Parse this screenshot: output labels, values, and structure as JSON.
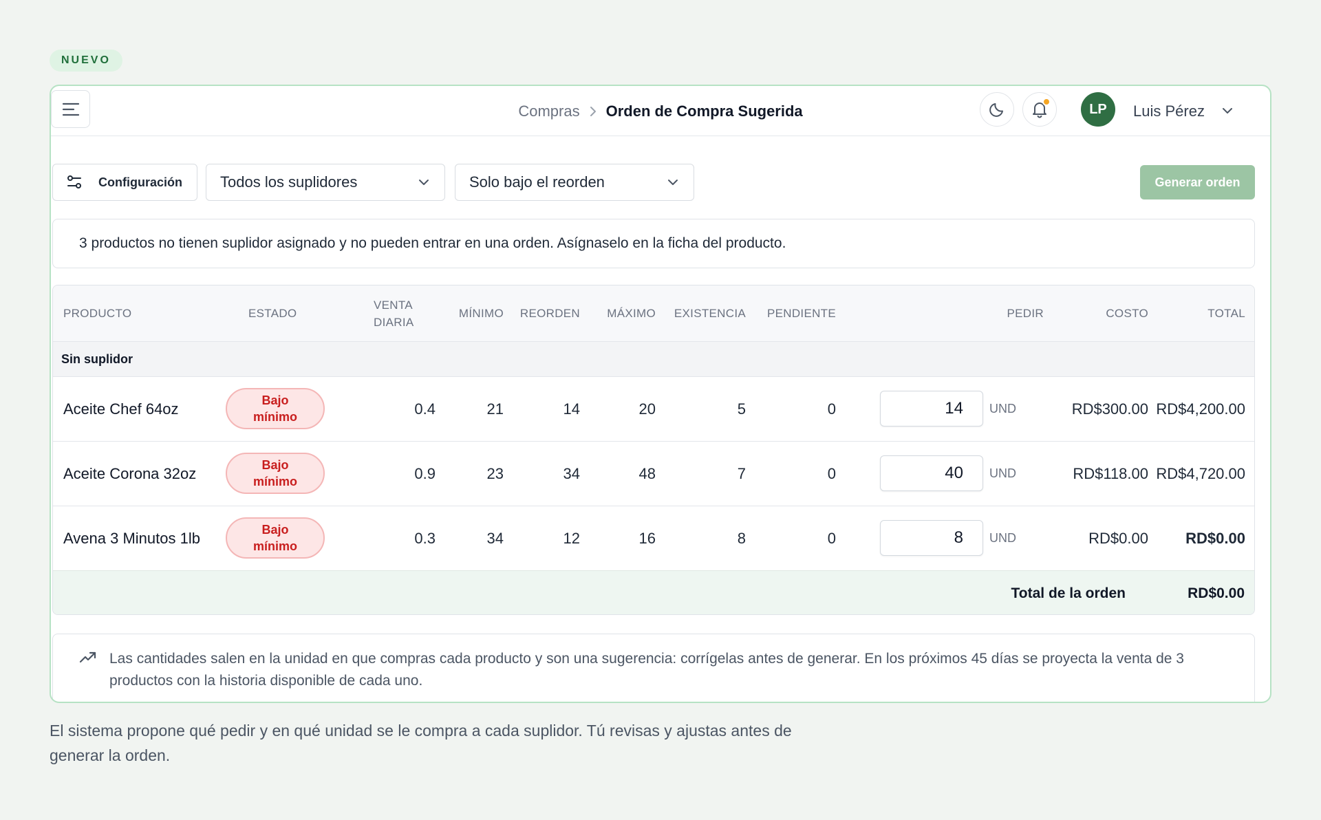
{
  "badge": "NUEVO",
  "header": {
    "breadcrumb_parent": "Compras",
    "breadcrumb_current": "Orden de Compra Sugerida",
    "user_initials": "LP",
    "user_name": "Luis Pérez"
  },
  "toolbar": {
    "config_label": "Configuración",
    "supplier_filter": "Todos los suplidores",
    "reorder_filter": "Solo bajo el reorden",
    "generate_label": "Generar orden"
  },
  "notice": "3 productos no tienen suplidor asignado y no pueden entrar en una orden. Asígnaselo en la ficha del producto.",
  "table": {
    "columns": {
      "producto": "PRODUCTO",
      "estado": "ESTADO",
      "venta_diaria_1": "VENTA",
      "venta_diaria_2": "DIARIA",
      "minimo": "MÍNIMO",
      "reorden": "REORDEN",
      "maximo": "MÁXIMO",
      "existencia": "EXISTENCIA",
      "pendiente": "PENDIENTE",
      "pedir": "PEDIR",
      "costo": "COSTO",
      "total": "TOTAL"
    },
    "group_label": "Sin suplidor",
    "rows": [
      {
        "producto": "Aceite Chef 64oz",
        "estado_1": "Bajo",
        "estado_2": "mínimo",
        "venta_diaria": "0.4",
        "minimo": "21",
        "reorden": "14",
        "maximo": "20",
        "existencia": "5",
        "pendiente": "0",
        "pedir": "14",
        "unidad": "UND",
        "costo": "RD$300.00",
        "total": "RD$4,200.00"
      },
      {
        "producto": "Aceite Corona 32oz",
        "estado_1": "Bajo",
        "estado_2": "mínimo",
        "venta_diaria": "0.9",
        "minimo": "23",
        "reorden": "34",
        "maximo": "48",
        "existencia": "7",
        "pendiente": "0",
        "pedir": "40",
        "unidad": "UND",
        "costo": "RD$118.00",
        "total": "RD$4,720.00"
      },
      {
        "producto": "Avena 3 Minutos 1lb",
        "estado_1": "Bajo",
        "estado_2": "mínimo",
        "venta_diaria": "0.3",
        "minimo": "34",
        "reorden": "12",
        "maximo": "16",
        "existencia": "8",
        "pendiente": "0",
        "pedir": "8",
        "unidad": "UND",
        "costo": "RD$0.00",
        "total": "RD$0.00"
      }
    ],
    "total_label": "Total de la orden",
    "total_value": "RD$0.00"
  },
  "info_text": "Las cantidades salen en la unidad en que compras cada producto y son una sugerencia: corrígelas antes de generar. En los próximos 45 días se proyecta la venta de 3 productos con la historia disponible de cada uno.",
  "caption": "El sistema propone qué pedir y en qué unidad se le compra a cada suplidor. Tú revisas y ajustas antes de generar la orden.",
  "colors": {
    "accent": "#2f6e43",
    "generate_button": "#9cc5a4",
    "status_danger": "#c81e1e",
    "notification_dot": "#f5a623"
  },
  "icons": [
    "menu-icon",
    "chevron-right-icon",
    "moon-icon",
    "bell-icon",
    "chevron-down-icon",
    "sliders-icon",
    "trending-up-icon"
  ]
}
